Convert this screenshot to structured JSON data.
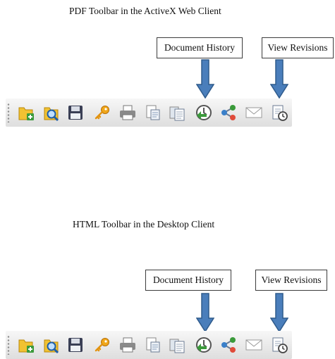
{
  "sections": [
    {
      "caption": "PDF Toolbar in the ActiveX Web Client",
      "callouts": {
        "document_history": "Document History",
        "view_revisions": "View Revisions"
      },
      "toolbar": [
        "new-document-icon",
        "search-document-icon",
        "save-disk-icon",
        "key-icon",
        "printer-icon",
        "copy-page-icon",
        "paste-page-icon",
        "document-history-icon",
        "share-icon",
        "email-icon",
        "view-revisions-icon"
      ]
    },
    {
      "caption": "HTML Toolbar in the Desktop Client",
      "callouts": {
        "document_history": "Document History",
        "view_revisions": "View Revisions"
      },
      "toolbar": [
        "new-document-icon",
        "search-document-icon",
        "save-disk-icon",
        "key-icon",
        "printer-icon",
        "copy-page-icon",
        "paste-page-icon",
        "document-history-icon",
        "share-icon",
        "email-icon",
        "view-revisions-icon"
      ]
    }
  ],
  "colors": {
    "arrow": "#4a7ebb",
    "arrow_outline": "#2f5b8c",
    "toolbar": "#e8e8e8"
  }
}
